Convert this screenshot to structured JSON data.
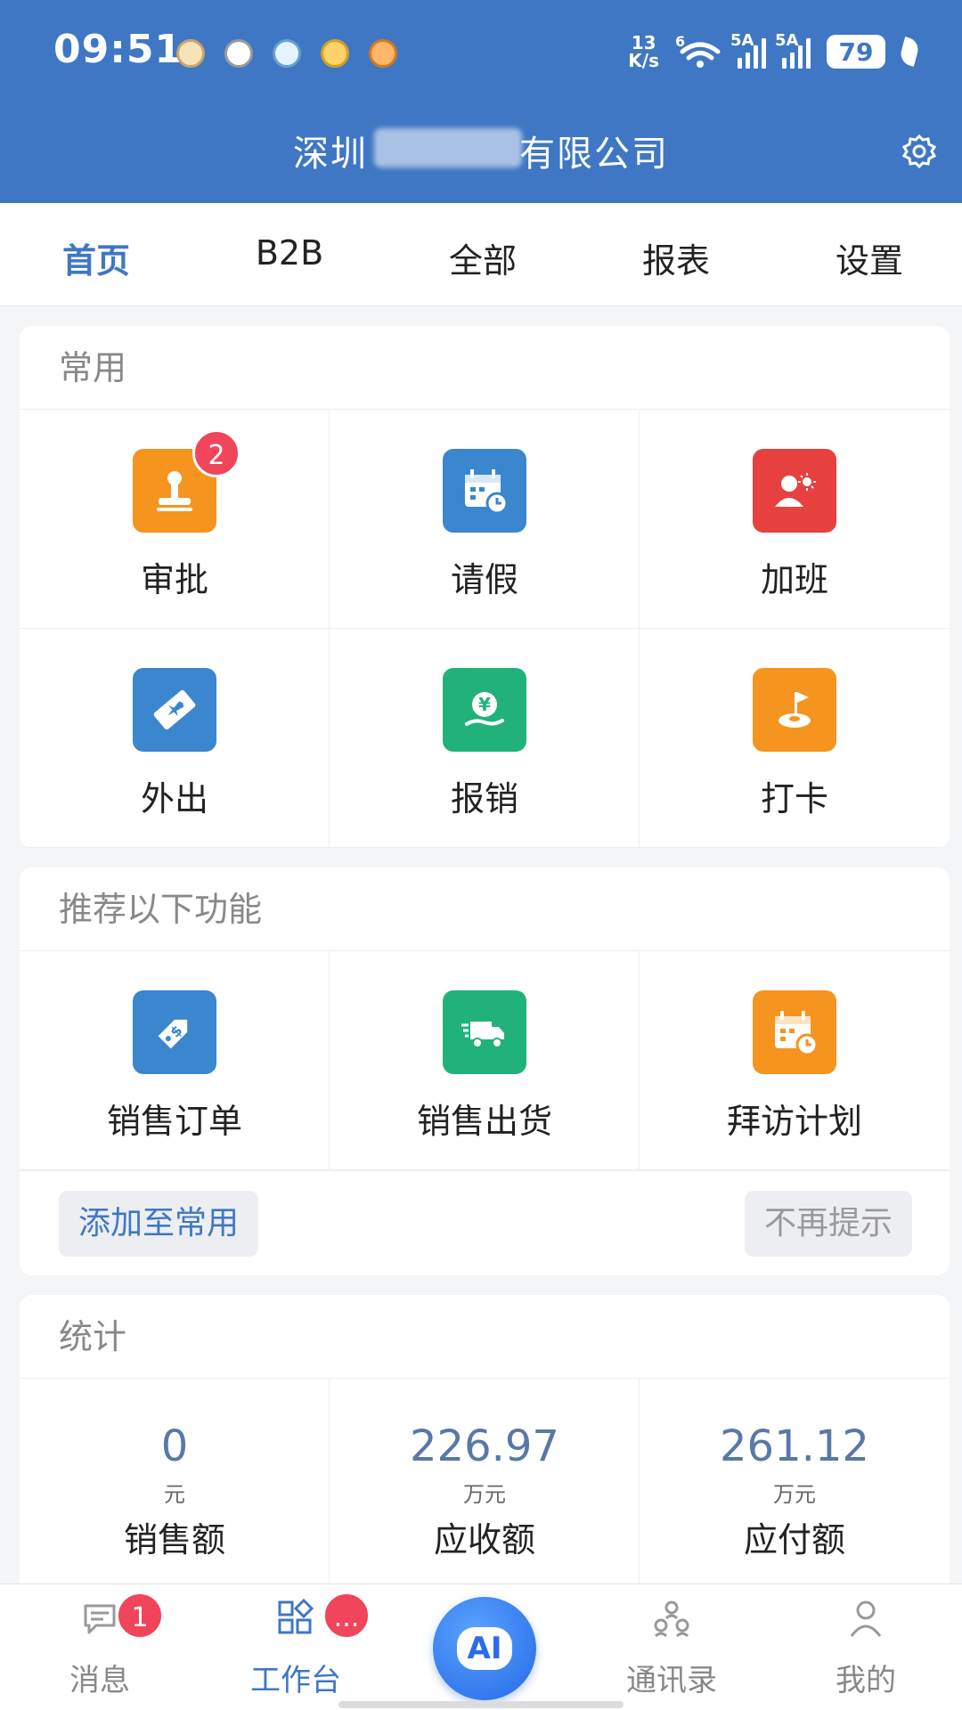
{
  "status_bar": {
    "time": "09:51",
    "net_speed_value": "13",
    "net_speed_unit": "K/s",
    "wifi_label": "6",
    "signal1_label": "5A",
    "signal2_label": "5A",
    "battery": "79"
  },
  "header": {
    "company_title_prefix": "深圳",
    "company_title_suffix": "有限公司"
  },
  "top_nav": {
    "tabs": [
      {
        "label": "首页",
        "active": true
      },
      {
        "label": "B2B",
        "active": false
      },
      {
        "label": "全部",
        "active": false
      },
      {
        "label": "报表",
        "active": false
      },
      {
        "label": "设置",
        "active": false
      }
    ]
  },
  "common": {
    "title": "常用",
    "items": [
      {
        "label": "审批",
        "icon": "stamp-icon",
        "color": "#f5941f",
        "badge": "2"
      },
      {
        "label": "请假",
        "icon": "calendar-clock-icon",
        "color": "#3a86cf"
      },
      {
        "label": "加班",
        "icon": "user-overtime-icon",
        "color": "#e6413f"
      },
      {
        "label": "外出",
        "icon": "plane-ticket-icon",
        "color": "#3a86cf"
      },
      {
        "label": "报销",
        "icon": "yuan-hand-icon",
        "color": "#21b27c"
      },
      {
        "label": "打卡",
        "icon": "location-flag-icon",
        "color": "#f5941f"
      }
    ]
  },
  "recommend": {
    "title": "推荐以下功能",
    "items": [
      {
        "label": "销售订单",
        "icon": "price-tag-icon",
        "color": "#3a86cf"
      },
      {
        "label": "销售出货",
        "icon": "truck-icon",
        "color": "#21b27c"
      },
      {
        "label": "拜访计划",
        "icon": "calendar-clock-icon",
        "color": "#f5941f"
      }
    ],
    "add_label": "添加至常用",
    "dismiss_label": "不再提示"
  },
  "stats": {
    "title": "统计",
    "items": [
      {
        "value": "0",
        "unit": "元",
        "label": "销售额"
      },
      {
        "value": "226.97",
        "unit": "万元",
        "label": "应收额"
      },
      {
        "value": "261.12",
        "unit": "万元",
        "label": "应付额"
      }
    ]
  },
  "bottom_nav": {
    "items": [
      {
        "label": "消息",
        "icon": "chat-bubble-icon",
        "badge": "1"
      },
      {
        "label": "工作台",
        "icon": "workbench-grid-icon",
        "badge": "...",
        "active": true
      },
      {
        "label": "AI",
        "icon": "ai-icon"
      },
      {
        "label": "通讯录",
        "icon": "contacts-icon"
      },
      {
        "label": "我的",
        "icon": "person-icon"
      }
    ]
  },
  "colors": {
    "header_blue": "#3f77c4",
    "badge_red": "#f0455a",
    "stat_value": "#5878a8"
  }
}
